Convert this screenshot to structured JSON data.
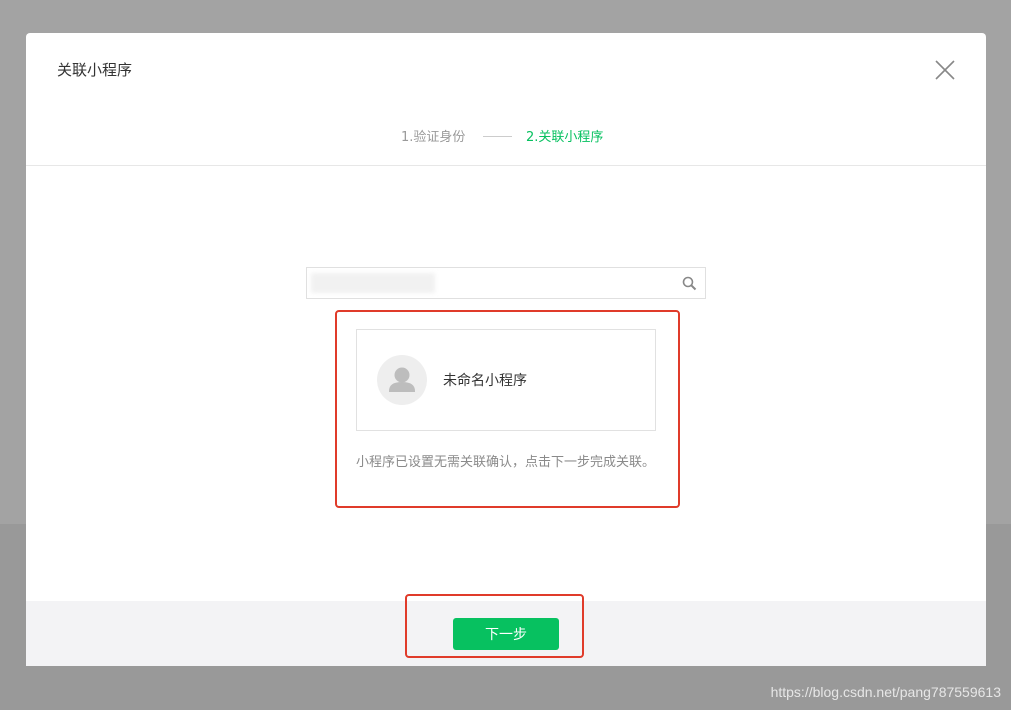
{
  "dialog": {
    "title": "关联小程序",
    "close_icon": "close-icon"
  },
  "steps": [
    {
      "label": "1.验证身份",
      "state": "done"
    },
    {
      "label": "2.关联小程序",
      "state": "active"
    }
  ],
  "search": {
    "value": "",
    "placeholder": "",
    "icon": "search-icon"
  },
  "result": {
    "app_name": "未命名小程序",
    "avatar_icon": "user-avatar-icon"
  },
  "note": "小程序已设置无需关联确认，点击下一步完成关联。",
  "footer": {
    "next_label": "下一步"
  },
  "watermark": "https://blog.csdn.net/pang787559613",
  "colors": {
    "accent": "#07c160",
    "highlight": "#e03b2a",
    "overlay": "#a3a3a3"
  }
}
